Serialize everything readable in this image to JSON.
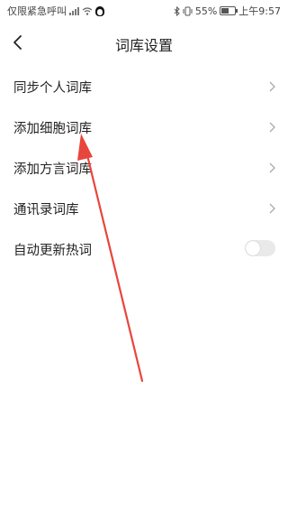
{
  "status_bar": {
    "left_text": "仅限紧急呼叫",
    "battery_text": "55%",
    "time_text": "上午9:57",
    "battery_level": 0.55,
    "icons": [
      "signal-icon",
      "wifi-icon",
      "qq-penguin-icon",
      "bluetooth-icon",
      "vibrate-icon",
      "battery-icon"
    ]
  },
  "header": {
    "title": "词库设置",
    "back_icon": "back-arrow-icon"
  },
  "settings": {
    "items": [
      {
        "label": "同步个人词库",
        "control": "chevron"
      },
      {
        "label": "添加细胞词库",
        "control": "chevron"
      },
      {
        "label": "添加方言词库",
        "control": "chevron"
      },
      {
        "label": "通讯录词库",
        "control": "chevron"
      },
      {
        "label": "自动更新热词",
        "control": "toggle",
        "value": false
      }
    ]
  },
  "annotation": {
    "type": "red-arrow",
    "color": "#e8453c",
    "points_to": "添加细胞词库"
  }
}
